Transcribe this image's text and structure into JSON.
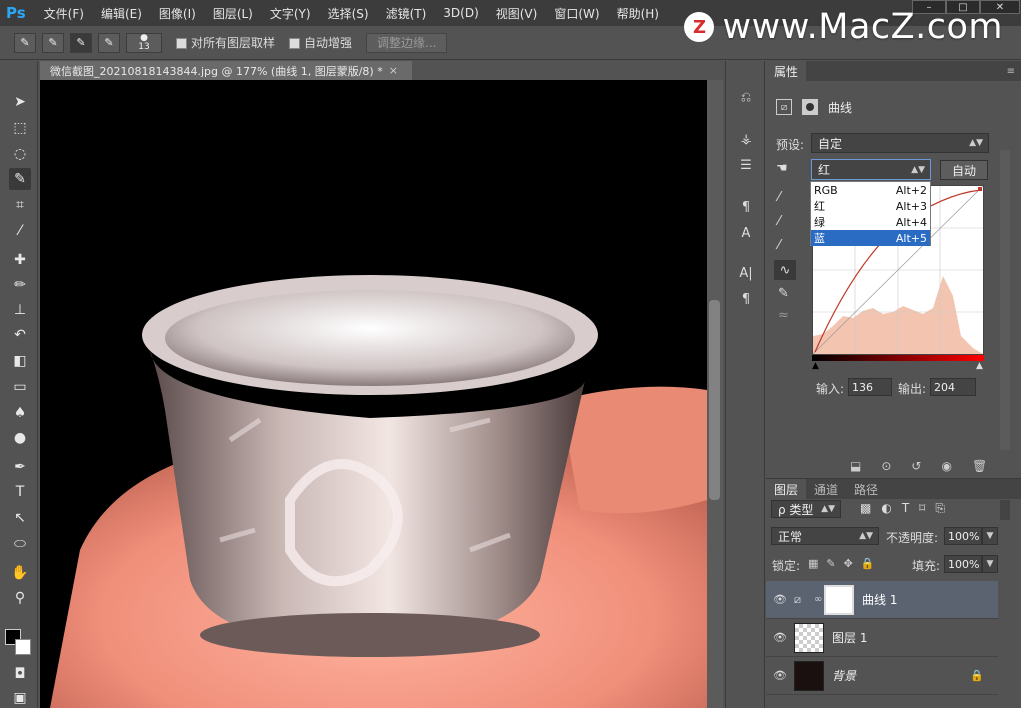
{
  "app": {
    "logo": "Ps"
  },
  "menu": [
    "文件(F)",
    "编辑(E)",
    "图像(I)",
    "图层(L)",
    "文字(Y)",
    "选择(S)",
    "滤镜(T)",
    "3D(D)",
    "视图(V)",
    "窗口(W)",
    "帮助(H)"
  ],
  "watermark": {
    "badge": "Z",
    "text": "www.MacZ.com"
  },
  "window_controls": {
    "minimize": "–",
    "maximize": "□",
    "close": "✕"
  },
  "options": {
    "brush_size": "13",
    "sample_all_layers": "对所有图层取样",
    "auto_enhance": "自动增强",
    "refine_edge": "调整边缘..."
  },
  "document": {
    "tab_title": "微信截图_20210818143844.jpg @ 177% (曲线 1, 图层蒙版/8) *",
    "close": "×"
  },
  "properties": {
    "tab": "属性",
    "title": "曲线",
    "preset_label": "预设:",
    "preset_value": "自定",
    "channel_value": "红",
    "auto_button": "自动",
    "channel_options": [
      {
        "name": "RGB",
        "shortcut": "Alt+2"
      },
      {
        "name": "红",
        "shortcut": "Alt+3"
      },
      {
        "name": "绿",
        "shortcut": "Alt+4"
      },
      {
        "name": "蓝",
        "shortcut": "Alt+5"
      }
    ],
    "input_label": "输入:",
    "input_value": "136",
    "output_label": "输出:",
    "output_value": "204"
  },
  "layers_panel": {
    "tabs": [
      "图层",
      "通道",
      "路径"
    ],
    "filter_label": "ρ 类型",
    "blend_mode": "正常",
    "opacity_label": "不透明度:",
    "opacity_value": "100%",
    "lock_label": "锁定:",
    "fill_label": "填充:",
    "fill_value": "100%",
    "layers": [
      {
        "name": "曲线 1",
        "selected": true
      },
      {
        "name": "图层 1",
        "selected": false
      },
      {
        "name": "背景",
        "selected": false
      }
    ]
  },
  "colors": {
    "selection": "#2a6bc4",
    "curve_red": "#c0392b",
    "histogram": "#f3c5b0"
  }
}
